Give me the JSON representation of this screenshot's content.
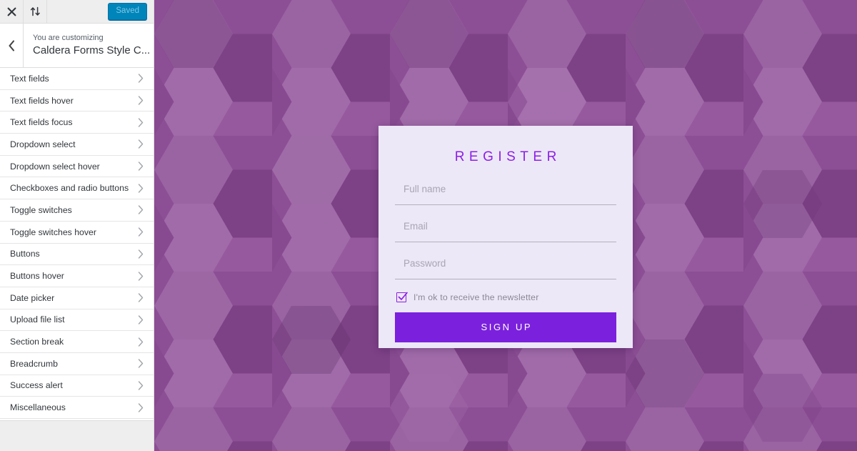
{
  "customizer": {
    "topbar": {
      "close_icon": "close-icon",
      "collapse_icon": "up-down-arrows-icon",
      "save_label": "Saved",
      "save_color": "#0085ba"
    },
    "header": {
      "back_icon": "chevron-left-icon",
      "eyebrow": "You are customizing",
      "title": "Caldera Forms Style C..."
    },
    "panel_items": [
      {
        "label": "Text fields"
      },
      {
        "label": "Text fields hover"
      },
      {
        "label": "Text fields focus"
      },
      {
        "label": "Dropdown select"
      },
      {
        "label": "Dropdown select hover"
      },
      {
        "label": "Checkboxes and radio buttons"
      },
      {
        "label": "Toggle switches"
      },
      {
        "label": "Toggle switches hover"
      },
      {
        "label": "Buttons"
      },
      {
        "label": "Buttons hover"
      },
      {
        "label": "Date picker"
      },
      {
        "label": "Upload file list"
      },
      {
        "label": "Section break"
      },
      {
        "label": "Breadcrumb"
      },
      {
        "label": "Success alert"
      },
      {
        "label": "Miscellaneous"
      }
    ]
  },
  "preview": {
    "background": {
      "pattern": "hexagon-honeycomb",
      "base_color": "#8c4e94",
      "shades": [
        "#9a63a2",
        "#8c4e94",
        "#7d4186",
        "#a271a8",
        "#743c7d"
      ]
    },
    "form": {
      "title": "REGISTER",
      "title_color": "#8d1ee8",
      "card_color": "#ece8f7",
      "fields": [
        {
          "name": "full-name",
          "placeholder": "Full name",
          "value": ""
        },
        {
          "name": "email",
          "placeholder": "Email",
          "value": ""
        },
        {
          "name": "password",
          "placeholder": "Password",
          "value": ""
        }
      ],
      "checkbox": {
        "label": "I'm ok to receive the newsletter",
        "checked": true,
        "color": "#8d1ee8"
      },
      "submit": {
        "label": "SIGN UP",
        "color": "#7b21dd"
      }
    }
  }
}
